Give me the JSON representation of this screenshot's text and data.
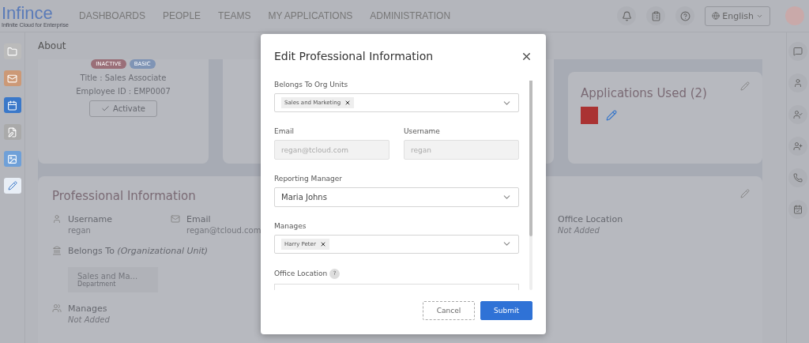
{
  "logo": {
    "name": "Infince",
    "tagline": "Infinite Cloud for Enterprise"
  },
  "nav": [
    {
      "label": "DASHBOARDS"
    },
    {
      "label": "PEOPLE"
    },
    {
      "label": "TEAMS"
    },
    {
      "label": "MY APPLICATIONS"
    },
    {
      "label": "ADMINISTRATION"
    }
  ],
  "language": {
    "label": "English"
  },
  "page_title": "About",
  "profile": {
    "badges": [
      {
        "label": "INACTIVE",
        "color": "#9a6f78"
      },
      {
        "label": "BASIC",
        "color": "#7f94b5"
      }
    ],
    "title": "Title : Sales Associate",
    "employee_id": "Employee ID : EMP0007",
    "activate_button": "Activate"
  },
  "applications": {
    "title": "Applications Used (2)"
  },
  "professional": {
    "title": "Professional Information",
    "fields": [
      {
        "label": "Username",
        "value": "regan",
        "kind": "user"
      },
      {
        "label": "Email",
        "value": "regan@tcloud.com",
        "kind": "mail"
      },
      {
        "label": "Office Location",
        "value": "Not Added",
        "kind": "none"
      }
    ],
    "belongs_to": {
      "label": "Belongs To ",
      "note": "(Organizational Unit)",
      "unit": "Sales and Ma...",
      "unit_type": "Department"
    },
    "manages": {
      "label": "Manages",
      "value": "Not Added"
    }
  },
  "modal": {
    "title": "Edit Professional Information",
    "org_units": {
      "label": "Belongs To Org Units",
      "tags": [
        "Sales and Marketing"
      ]
    },
    "email": {
      "label": "Email",
      "value": "regan@tcloud.com",
      "disabled": true
    },
    "username": {
      "label": "Username",
      "value": "regan",
      "disabled": true
    },
    "reporting_manager": {
      "label": "Reporting Manager",
      "value": "Maria Johns"
    },
    "manages": {
      "label": "Manages",
      "tags": [
        "Harry Peter"
      ]
    },
    "office_location": {
      "label": "Office Location",
      "help": "?"
    },
    "buttons": [
      {
        "label": "Cancel",
        "kind": "secondary"
      },
      {
        "label": "Submit",
        "kind": "primary"
      }
    ]
  }
}
